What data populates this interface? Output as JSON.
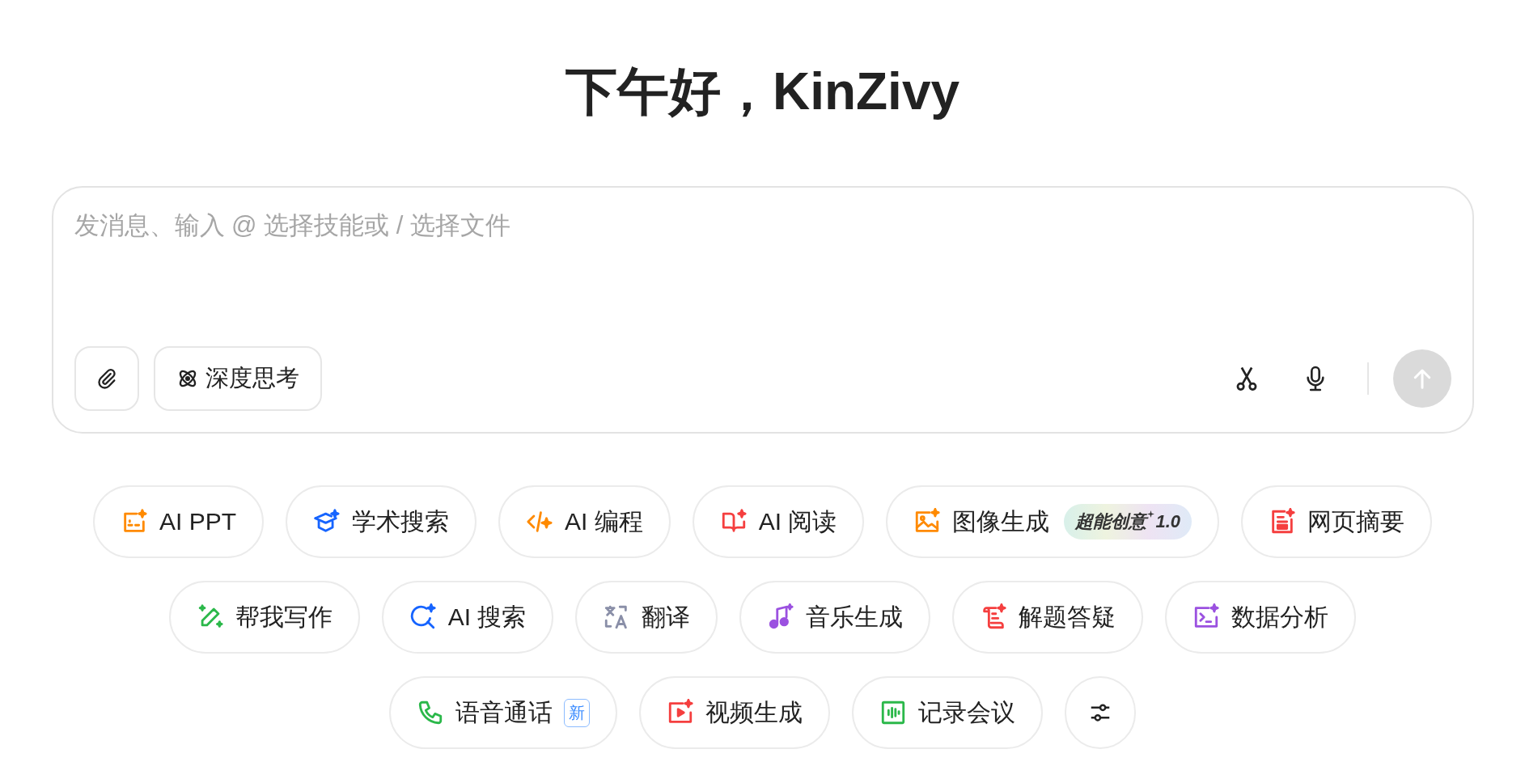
{
  "greeting": "下午好，KinZivy",
  "composer": {
    "placeholder": "发消息、输入 @ 选择技能或 / 选择文件",
    "deep_think": {
      "label": "深度思考",
      "selected": false
    },
    "send": {
      "disabled": true
    }
  },
  "skill_rows": [
    {
      "chips": [
        {
          "kind": "ppt",
          "label": "AI PPT",
          "color": "#ff8a00"
        },
        {
          "kind": "academic",
          "label": "学术搜索",
          "color": "#1664ff"
        },
        {
          "kind": "code",
          "label": "AI 编程",
          "color": "#ff8a00"
        },
        {
          "kind": "read",
          "label": "AI 阅读",
          "color": "#f53f3f"
        },
        {
          "kind": "image",
          "label": "图像生成",
          "color": "#ff8a00",
          "badge": {
            "text": "超能创意",
            "version": "1.0"
          }
        },
        {
          "kind": "web",
          "label": "网页摘要",
          "color": "#f53f3f"
        }
      ]
    },
    {
      "chips": [
        {
          "kind": "write",
          "label": "帮我写作",
          "color": "#2bb84a"
        },
        {
          "kind": "search",
          "label": "AI 搜索",
          "color": "#1664ff"
        },
        {
          "kind": "translate",
          "label": "翻译",
          "color": "#8a8fa8"
        },
        {
          "kind": "music",
          "label": "音乐生成",
          "color": "#9b51e0"
        },
        {
          "kind": "solve",
          "label": "解题答疑",
          "color": "#f53f3f"
        },
        {
          "kind": "data",
          "label": "数据分析",
          "color": "#9b51e0"
        }
      ]
    },
    {
      "chips": [
        {
          "kind": "phone",
          "label": "语音通话",
          "color": "#2bb84a",
          "new_tag": "新"
        },
        {
          "kind": "video",
          "label": "视频生成",
          "color": "#f53f3f"
        },
        {
          "kind": "meeting",
          "label": "记录会议",
          "color": "#2bb84a"
        }
      ]
    }
  ]
}
